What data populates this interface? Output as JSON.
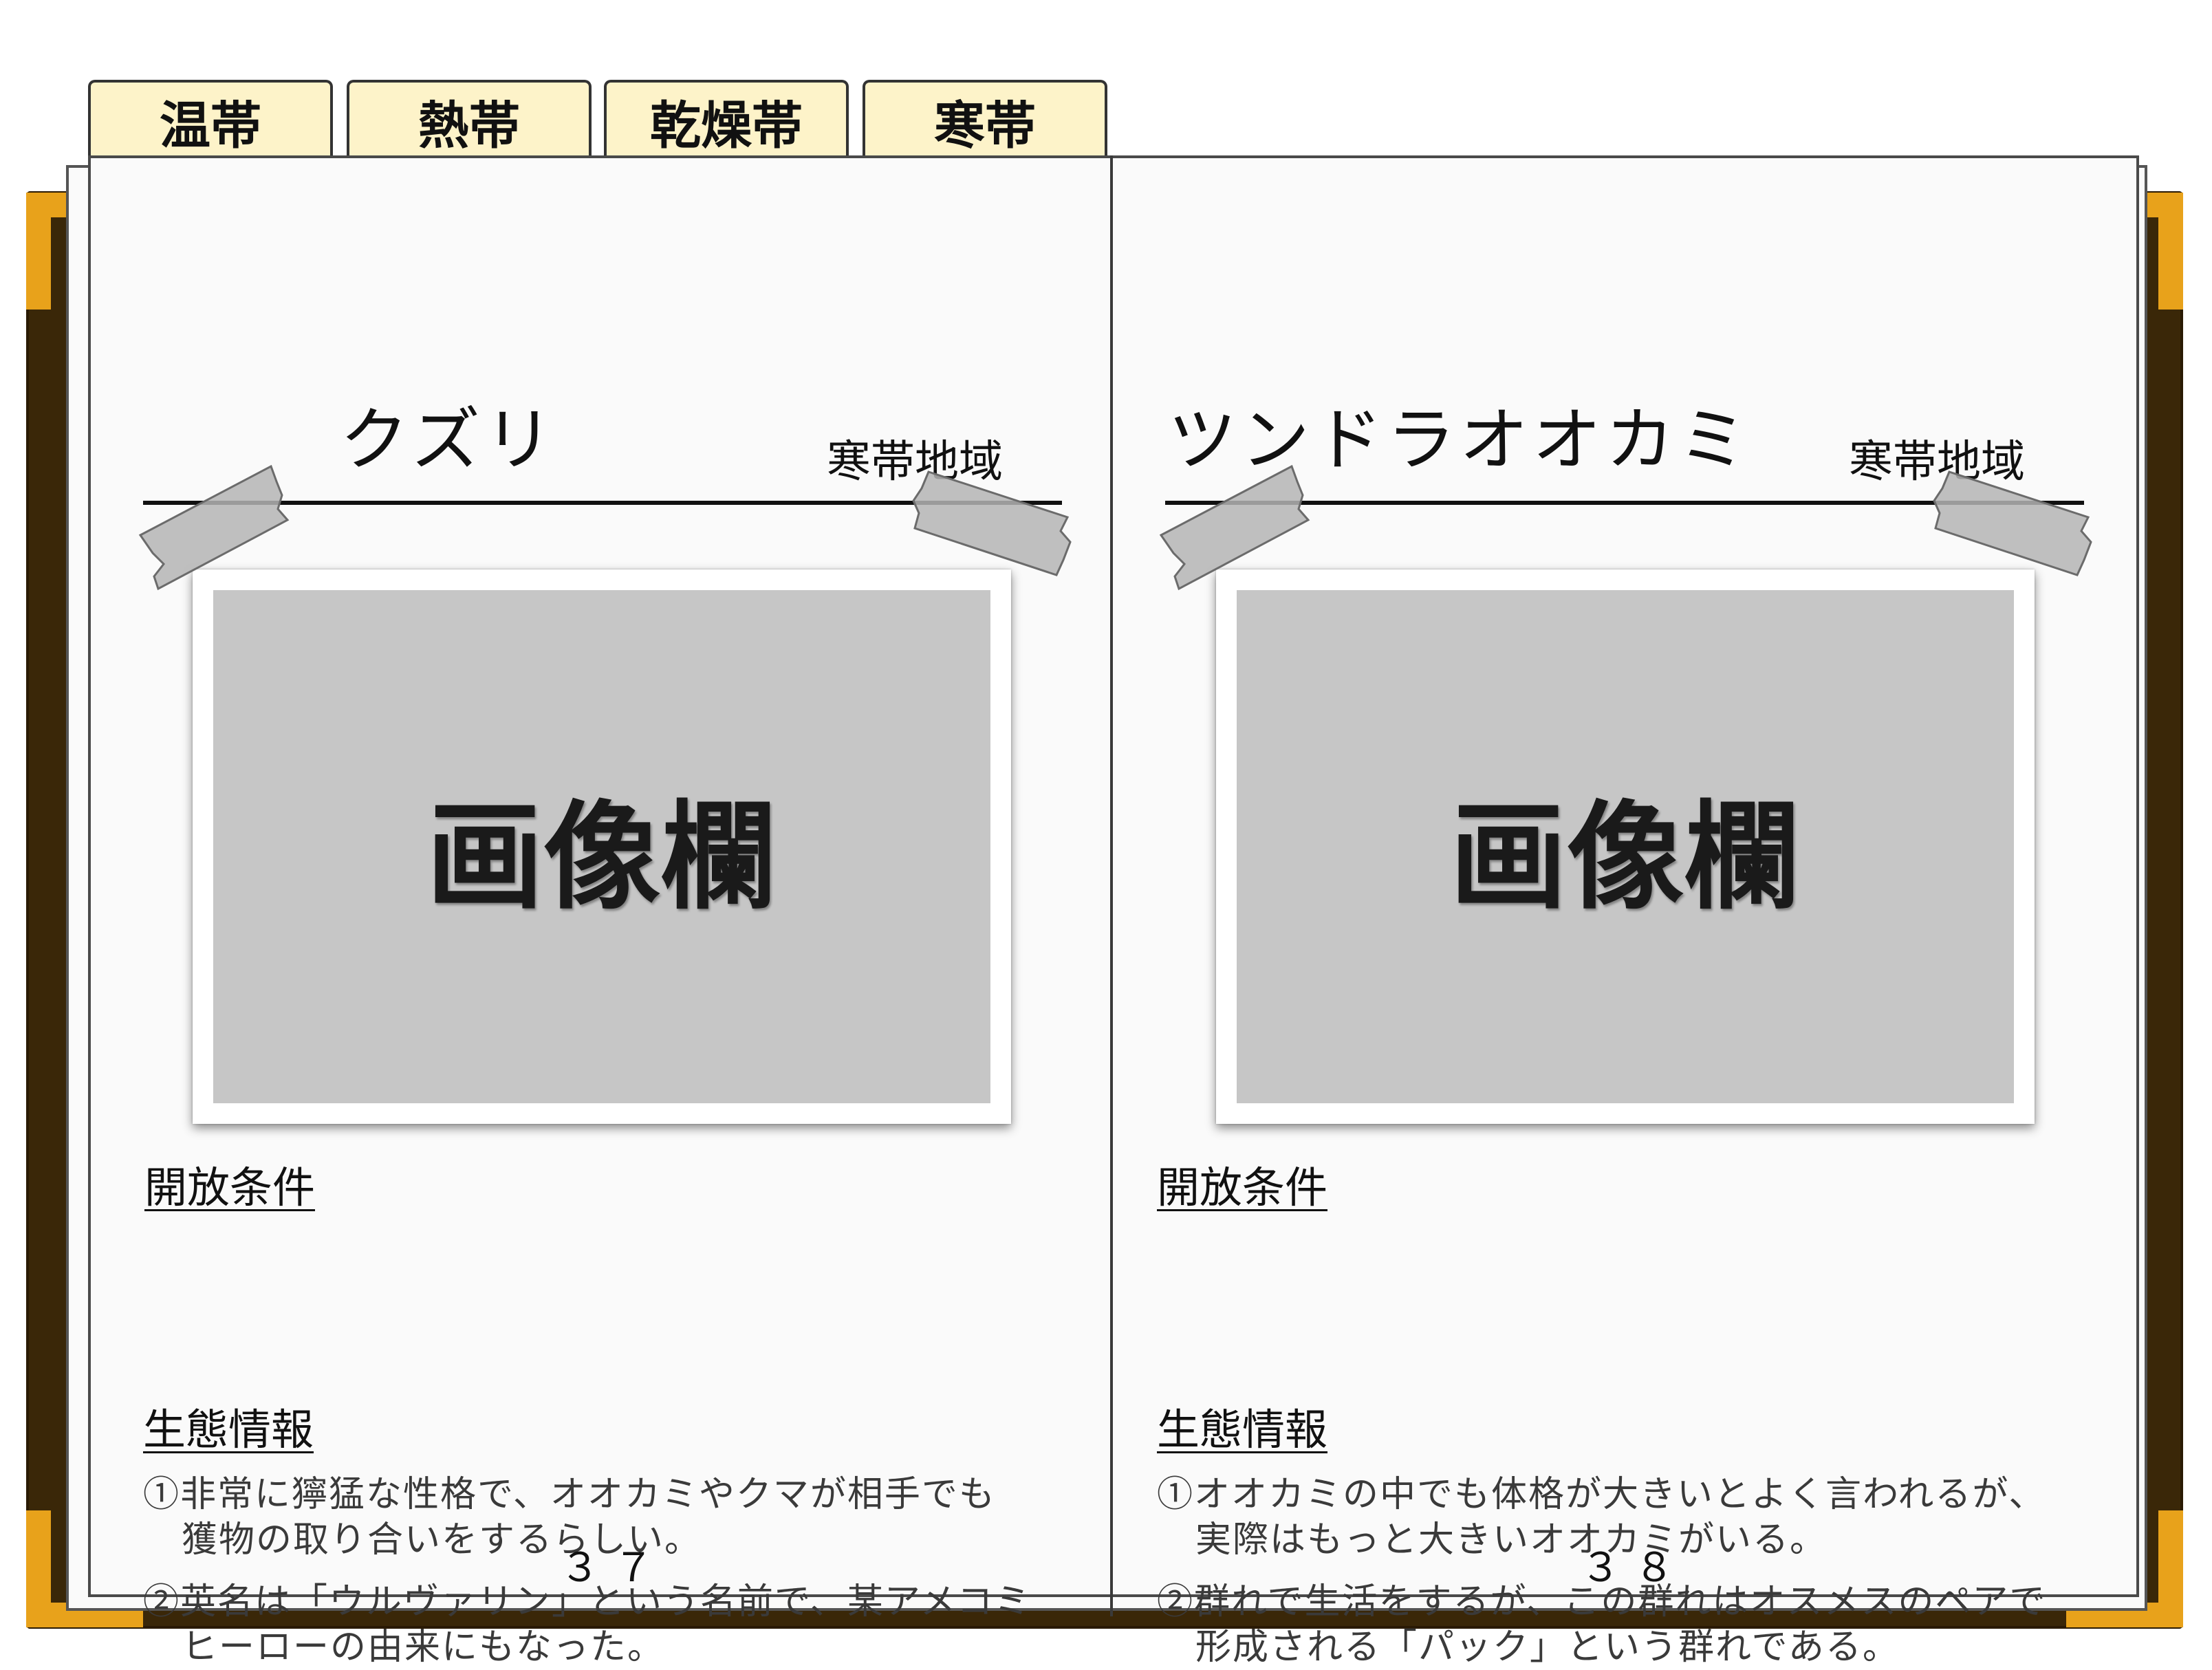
{
  "tabs": [
    "温帯",
    "熱帯",
    "乾燥帯",
    "寒帯"
  ],
  "photo_placeholder": "画像欄",
  "left_page": {
    "title": "クズリ",
    "region": "寒帯地域",
    "unlock_heading": "開放条件",
    "ecology_heading": "生態情報",
    "note1_line1": "①非常に獰猛な性格で、オオカミやクマが相手でも",
    "note1_line2": "獲物の取り合いをするらしい。",
    "note2_line1": "②英名は「ウルヴァリン」という名前で、某アメコミ",
    "note2_line2": "ヒーローの由来にもなった。",
    "page_number": "３７"
  },
  "right_page": {
    "title": "ツンドラオオカミ",
    "region": "寒帯地域",
    "unlock_heading": "開放条件",
    "ecology_heading": "生態情報",
    "note1_line1": "①オオカミの中でも体格が大きいとよく言われるが、",
    "note1_line2": "実際はもっと大きいオオカミがいる。",
    "note2_line1": "②群れで生活をするが、この群れはオスメスのペアで",
    "note2_line2": "形成される「パック」という群れである。",
    "page_number": "３８"
  },
  "colors": {
    "cover": "#3a2708",
    "corner": "#e8a21b",
    "tab_fill": "#fdf3c9",
    "page": "#fafafa",
    "photo": "#c6c6c6",
    "tape": "#b4b4b4"
  }
}
